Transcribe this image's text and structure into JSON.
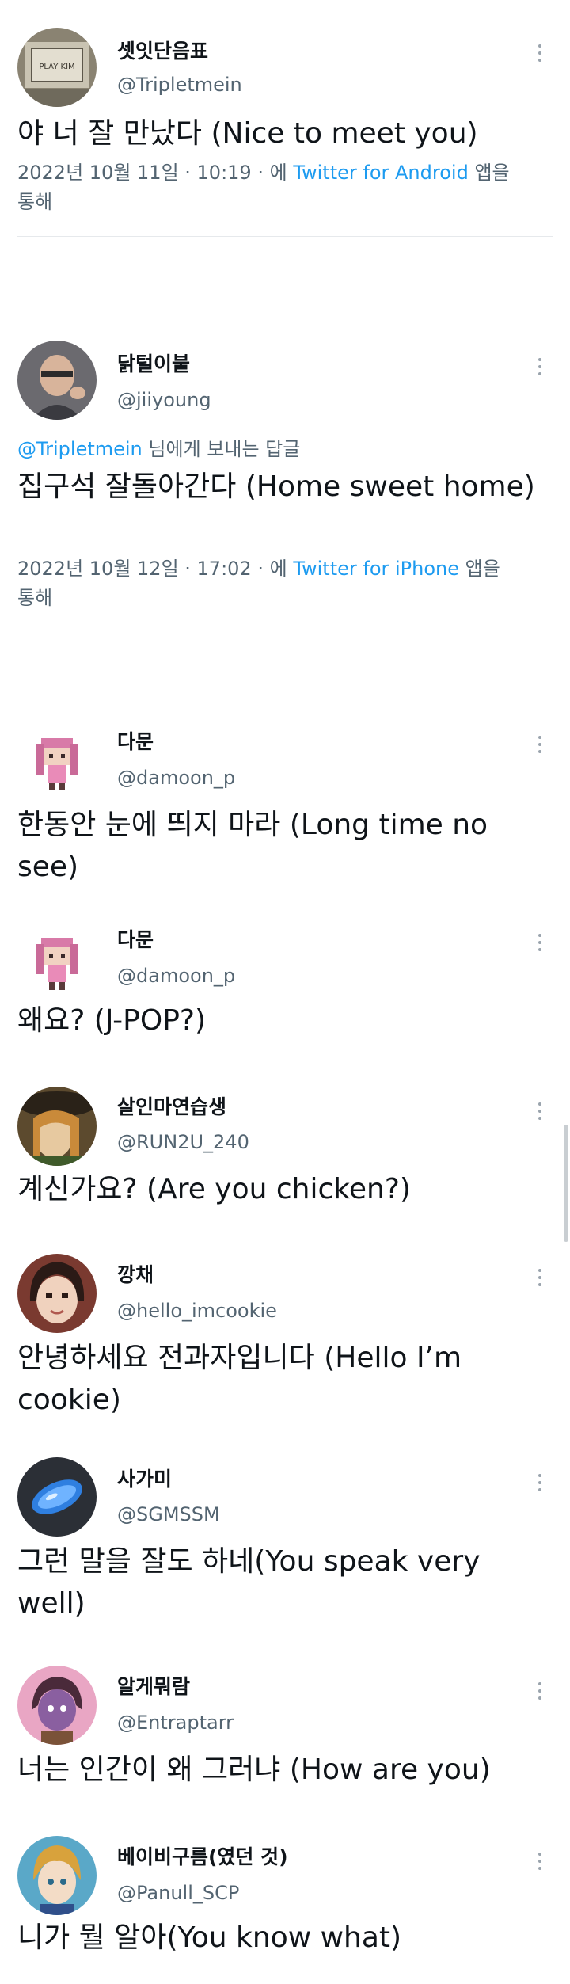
{
  "tweets": [
    {
      "name": "셋잇단음표",
      "handle": "@Tripletmein",
      "avatar": "avatar-framed-photo",
      "text": "야 너 잘 만났다 (Nice to meet you)",
      "date": "2022년 10월 11일 · 10:19 · 에",
      "client": "Twitter for Android",
      "client_suffix": "앱을",
      "via": "통해"
    },
    {
      "name": "닭털이불",
      "handle": "@jiiyoung",
      "avatar": "avatar-man-photo",
      "reply_to": "@Tripletmein",
      "reply_suffix": "님에게 보내는 답글",
      "text": "집구석 잘돌아간다 (Home sweet home)",
      "date": "2022년 10월 12일 · 17:02 · 에",
      "client": "Twitter for iPhone",
      "client_suffix": "앱을",
      "via": "통해"
    },
    {
      "name": "다문",
      "handle": "@damoon_p",
      "avatar": "avatar-pixel-character",
      "text": "한동안 눈에 띄지 마라 (Long time no see)"
    },
    {
      "name": "다문",
      "handle": "@damoon_p",
      "avatar": "avatar-pixel-character",
      "text": "왜요? (J-POP?)"
    },
    {
      "name": "살인마연습생",
      "handle": "@RUN2U_240",
      "avatar": "avatar-hat-illustration",
      "text": "계신가요? (Are you chicken?)"
    },
    {
      "name": "깡채",
      "handle": "@hello_imcookie",
      "avatar": "avatar-anime-girl",
      "text": "안녕하세요 전과자입니다 (Hello I’m cookie)"
    },
    {
      "name": "사가미",
      "handle": "@SGMSSM",
      "avatar": "avatar-blue-object",
      "text": "그런 말을 잘도 하네(You speak very well)"
    },
    {
      "name": "알게뭐람",
      "handle": "@Entraptarr",
      "avatar": "avatar-cartoon-character",
      "text": "너는 인간이 왜 그러냐 (How are you)"
    },
    {
      "name": "베이비구름(였던 것)",
      "handle": "@Panull_SCP",
      "avatar": "avatar-anime-boy",
      "text": "니가 뭘 알아(You know what)"
    }
  ],
  "colors": {
    "text": "#0f1419",
    "secondary": "#536471",
    "link": "#1d9bf0",
    "divider": "#e6e9ec"
  },
  "icons": {
    "more": "more-options-icon"
  }
}
